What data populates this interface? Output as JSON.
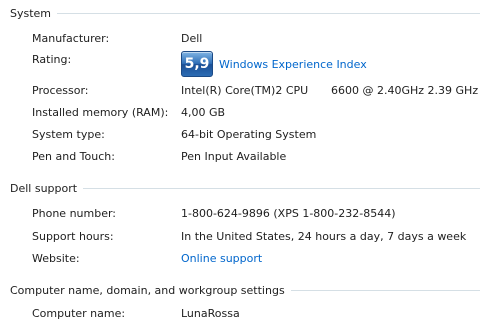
{
  "system": {
    "header": "System",
    "manufacturer_label": "Manufacturer:",
    "manufacturer_value": "Dell",
    "rating_label": "Rating:",
    "rating_score": "5,9",
    "rating_link": "Windows Experience Index",
    "processor_label": "Processor:",
    "processor_name": "Intel(R) Core(TM)2 CPU",
    "processor_model": "6600  @ 2.40GHz   2.39 GHz",
    "memory_label": "Installed memory (RAM):",
    "memory_value": "4,00 GB",
    "system_type_label": "System type:",
    "system_type_value": "64-bit Operating System",
    "pen_label": "Pen and Touch:",
    "pen_value": "Pen Input Available"
  },
  "dell_support": {
    "header": "Dell support",
    "phone_label": "Phone number:",
    "phone_value": "1-800-624-9896 (XPS 1-800-232-8544)",
    "hours_label": "Support hours:",
    "hours_value": "In the United States, 24 hours a day, 7 days a week",
    "website_label": "Website:",
    "website_link": "Online support"
  },
  "computer_name": {
    "header": "Computer name, domain, and workgroup settings",
    "name_label": "Computer name:",
    "name_value": "LunaRossa"
  },
  "colors": {
    "link": "#0066cc",
    "rule": "#d5dfe5",
    "badge": "#2f6fb7"
  }
}
